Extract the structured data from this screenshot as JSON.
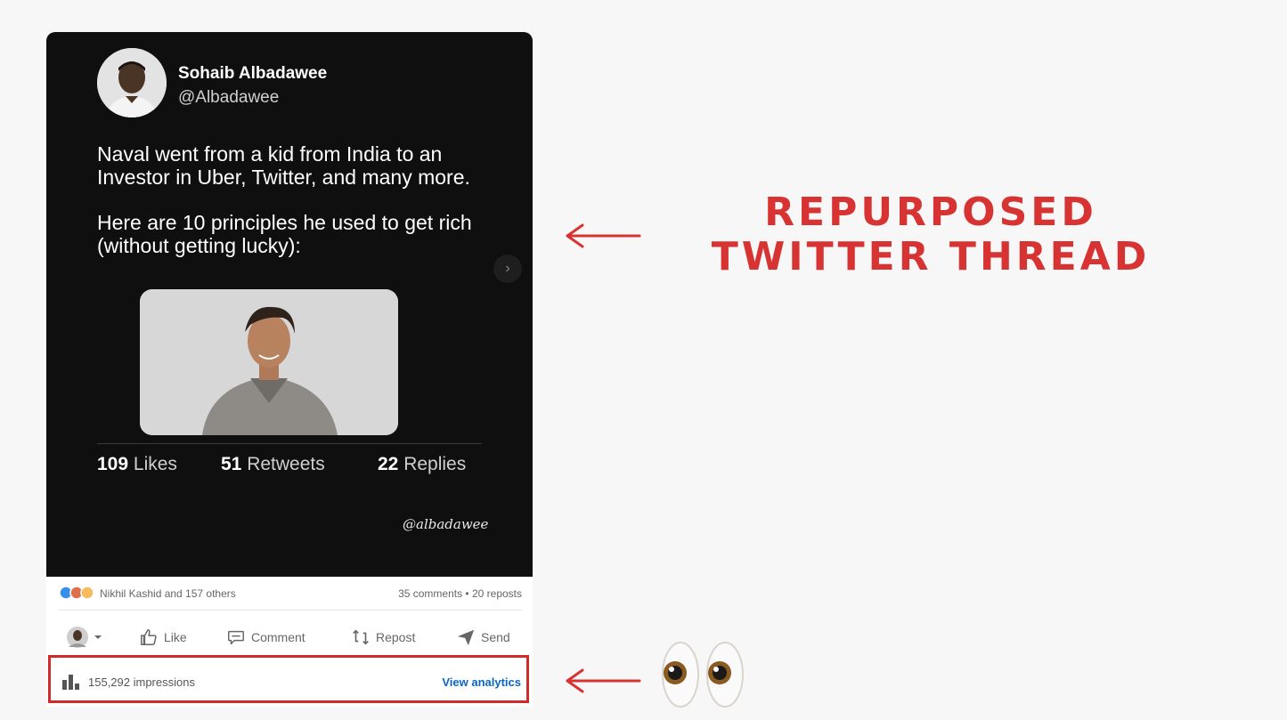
{
  "tweet": {
    "author_name": "Sohaib Albadawee",
    "author_handle": "@Albadawee",
    "paragraph1": "Naval went from a kid from India to an Investor in Uber, Twitter, and many more.",
    "paragraph2": "Here are 10 principles he used to get rich (without getting lucky):",
    "likes_count": "109",
    "likes_label": "Likes",
    "retweets_count": "51",
    "retweets_label": "Retweets",
    "replies_count": "22",
    "replies_label": "Replies",
    "watermark": "@albadawee",
    "next_glyph": "›"
  },
  "linkedin": {
    "reactions_text": "Nikhil Kashid and 157 others",
    "counts_text": "35 comments • 20 reposts",
    "actions": {
      "like": "Like",
      "comment": "Comment",
      "repost": "Repost",
      "send": "Send"
    },
    "impressions": "155,292 impressions",
    "view_analytics": "View analytics"
  },
  "annotation": {
    "title": "REPURPOSED TWITTER THREAD"
  },
  "colors": {
    "card_bg": "#0f0f0f",
    "annotation_red": "#d83333",
    "link_blue": "#0a66c2"
  },
  "icons": [
    "chevron-right-icon",
    "like-icon",
    "comment-icon",
    "repost-icon",
    "send-icon",
    "analytics-bar-icon",
    "arrow-left-icon",
    "eyes-emoji"
  ]
}
